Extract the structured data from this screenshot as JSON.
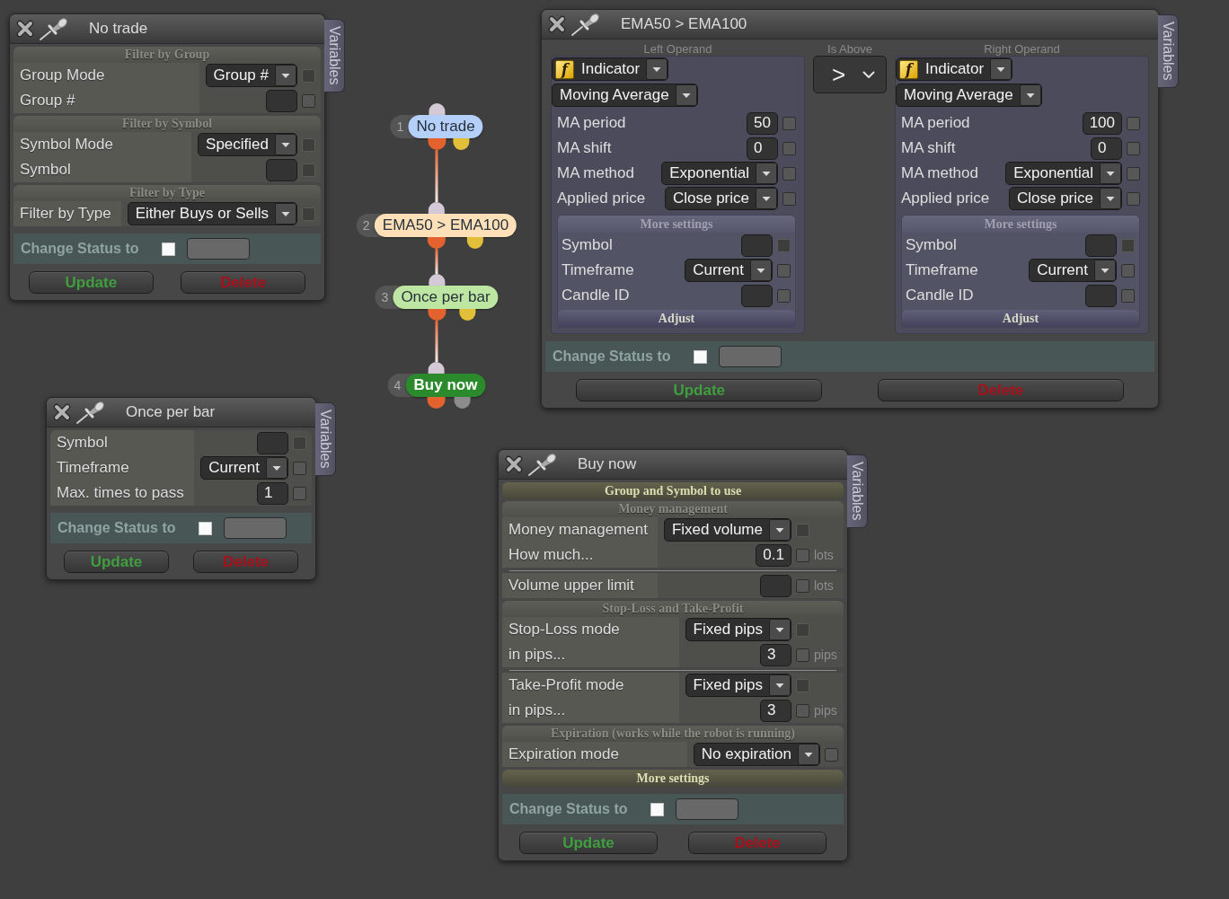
{
  "panels": [
    {
      "title": "No trade",
      "side_tab": "Variables",
      "blocks": [
        {
          "kind": "section",
          "title": "Filter by Group",
          "groups": [
            [
              {
                "kind": "select",
                "label": "Group Mode",
                "value": "Group #",
                "checkbox": {
                  "checked": false,
                  "disabled": true
                }
              },
              {
                "kind": "input",
                "label": "Group #",
                "checkbox": {
                  "checked": false,
                  "disabled": false
                }
              }
            ]
          ]
        },
        {
          "kind": "section",
          "title": "Filter by Symbol",
          "groups": [
            [
              {
                "kind": "select",
                "label": "Symbol Mode",
                "value": "Specified",
                "checkbox": {
                  "checked": false,
                  "disabled": true
                }
              },
              {
                "kind": "input",
                "label": "Symbol",
                "checkbox": {
                  "checked": false,
                  "disabled": true
                }
              }
            ]
          ]
        },
        {
          "kind": "section",
          "title": "Filter by Type",
          "groups": [
            [
              {
                "kind": "select",
                "label": "Filter by Type",
                "value": "Either Buys or Sells",
                "checkbox": {
                  "checked": false,
                  "disabled": true
                }
              }
            ]
          ]
        }
      ],
      "status": {
        "label": "Change Status to",
        "checked": false
      },
      "buttons": [
        {
          "kind": "update",
          "label": "Update"
        },
        {
          "kind": "delete",
          "label": "Delete"
        }
      ]
    },
    {
      "title": "EMA50 > EMA100",
      "side_tab": "Variables",
      "blocks": [
        {
          "kind": "comparison",
          "left": {
            "heading": "Left Operand",
            "source": {
              "icon": "f",
              "value": "Indicator"
            },
            "indicator": "Moving Average",
            "rows": [
              {
                "kind": "input",
                "label": "MA period",
                "value": "50",
                "checkbox": {
                  "checked": false,
                  "disabled": false
                }
              },
              {
                "kind": "input",
                "label": "MA shift",
                "value": "0",
                "checkbox": {
                  "checked": false,
                  "disabled": false
                }
              },
              {
                "kind": "select",
                "label": "MA method",
                "value": "Exponential",
                "checkbox": {
                  "checked": false,
                  "disabled": false
                }
              },
              {
                "kind": "select",
                "label": "Applied price",
                "value": "Close price",
                "checkbox": {
                  "checked": false,
                  "disabled": false
                }
              }
            ],
            "more": {
              "title": "More settings",
              "rows": [
                {
                  "kind": "input",
                  "label": "Symbol",
                  "checkbox": {
                    "checked": false,
                    "disabled": true
                  }
                },
                {
                  "kind": "select",
                  "label": "Timeframe",
                  "value": "Current",
                  "checkbox": {
                    "checked": false,
                    "disabled": false
                  }
                },
                {
                  "kind": "input",
                  "label": "Candle ID",
                  "checkbox": {
                    "checked": false,
                    "disabled": false
                  }
                }
              ],
              "footer": "Adjust"
            }
          },
          "operator": {
            "heading": "Is Above",
            "value": ">"
          },
          "right": {
            "heading": "Right Operand",
            "source": {
              "icon": "f",
              "value": "Indicator"
            },
            "indicator": "Moving Average",
            "rows": [
              {
                "kind": "input",
                "label": "MA period",
                "value": "100",
                "checkbox": {
                  "checked": false,
                  "disabled": false
                }
              },
              {
                "kind": "input",
                "label": "MA shift",
                "value": "0",
                "checkbox": {
                  "checked": false,
                  "disabled": false
                }
              },
              {
                "kind": "select",
                "label": "MA method",
                "value": "Exponential",
                "checkbox": {
                  "checked": false,
                  "disabled": false
                }
              },
              {
                "kind": "select",
                "label": "Applied price",
                "value": "Close price",
                "checkbox": {
                  "checked": false,
                  "disabled": false
                }
              }
            ],
            "more": {
              "title": "More settings",
              "rows": [
                {
                  "kind": "input",
                  "label": "Symbol",
                  "checkbox": {
                    "checked": false,
                    "disabled": true
                  }
                },
                {
                  "kind": "select",
                  "label": "Timeframe",
                  "value": "Current",
                  "checkbox": {
                    "checked": false,
                    "disabled": false
                  }
                },
                {
                  "kind": "input",
                  "label": "Candle ID",
                  "checkbox": {
                    "checked": false,
                    "disabled": false
                  }
                }
              ],
              "footer": "Adjust"
            }
          }
        }
      ],
      "status": {
        "label": "Change Status to",
        "checked": false
      },
      "buttons": [
        {
          "kind": "update",
          "label": "Update"
        },
        {
          "kind": "delete",
          "label": "Delete"
        }
      ]
    },
    {
      "title": "Once per bar",
      "side_tab": "Variables",
      "blocks": [
        {
          "kind": "section",
          "groups": [
            [
              {
                "kind": "input",
                "label": "Symbol",
                "checkbox": {
                  "checked": false,
                  "disabled": true
                }
              },
              {
                "kind": "select",
                "label": "Timeframe",
                "value": "Current",
                "checkbox": {
                  "checked": false,
                  "disabled": false
                }
              },
              {
                "kind": "input",
                "label": "Max. times to pass",
                "value": "1",
                "checkbox": {
                  "checked": false,
                  "disabled": false
                }
              }
            ]
          ]
        }
      ],
      "status": {
        "label": "Change Status to",
        "checked": false
      },
      "buttons": [
        {
          "kind": "update",
          "label": "Update"
        },
        {
          "kind": "delete",
          "label": "Delete"
        }
      ]
    },
    {
      "title": "Buy now",
      "side_tab": "Variables",
      "blocks": [
        {
          "kind": "header",
          "title": "Group and Symbol to use"
        },
        {
          "kind": "section",
          "title": "Money management",
          "groups": [
            [
              {
                "kind": "select",
                "label": "Money management",
                "value": "Fixed volume",
                "checkbox": {
                  "checked": false,
                  "disabled": true
                }
              },
              {
                "kind": "input",
                "label": "How much...",
                "value": "0.1",
                "unit": "lots",
                "checkbox": {
                  "checked": false,
                  "disabled": false
                }
              }
            ],
            [
              {
                "kind": "input",
                "label": "Volume upper limit",
                "unit": "lots",
                "checkbox": {
                  "checked": false,
                  "disabled": false
                }
              }
            ]
          ]
        },
        {
          "kind": "section",
          "title": "Stop-Loss and Take-Profit",
          "groups": [
            [
              {
                "kind": "select",
                "label": "Stop-Loss mode",
                "value": "Fixed pips",
                "checkbox": {
                  "checked": false,
                  "disabled": true
                }
              },
              {
                "kind": "input",
                "label": "in pips...",
                "value": "3",
                "unit": "pips",
                "checkbox": {
                  "checked": false,
                  "disabled": false
                }
              }
            ],
            [
              {
                "kind": "select",
                "label": "Take-Profit mode",
                "value": "Fixed pips",
                "checkbox": {
                  "checked": false,
                  "disabled": true
                }
              },
              {
                "kind": "input",
                "label": "in pips...",
                "value": "3",
                "unit": "pips",
                "checkbox": {
                  "checked": false,
                  "disabled": false
                }
              }
            ]
          ]
        },
        {
          "kind": "section",
          "title": "Expiration (works while the robot is running)",
          "groups": [
            [
              {
                "kind": "select",
                "label": "Expiration mode",
                "value": "No expiration",
                "checkbox": {
                  "checked": false,
                  "disabled": false
                }
              }
            ]
          ]
        },
        {
          "kind": "header",
          "title": "More settings"
        }
      ],
      "status": {
        "label": "Change Status to",
        "checked": false
      },
      "buttons": [
        {
          "kind": "update",
          "label": "Update"
        },
        {
          "kind": "delete",
          "label": "Delete"
        }
      ]
    }
  ],
  "flow": {
    "nodes": [
      {
        "number": "1",
        "label": "No trade",
        "kind": "condition",
        "color": "#b4cff8",
        "ports": [
          {
            "color": "#e4622e"
          },
          {
            "color": "#e2bf38"
          }
        ]
      },
      {
        "number": "2",
        "label": "EMA50 > EMA100",
        "kind": "condition",
        "color": "#fde0b8",
        "ports": [
          {
            "color": "#e4622e"
          },
          {
            "color": "#e2bf38"
          }
        ]
      },
      {
        "number": "3",
        "label": "Once per bar",
        "kind": "condition",
        "color": "#bde6a2",
        "ports": [
          {
            "color": "#e4622e"
          },
          {
            "color": "#e2bf38"
          }
        ]
      },
      {
        "number": "4",
        "label": "Buy now",
        "kind": "action",
        "color": "#2b8a2b",
        "ports": [
          {
            "color": "#e4622e"
          },
          {
            "color": "#8c8c8c"
          }
        ]
      }
    ]
  }
}
